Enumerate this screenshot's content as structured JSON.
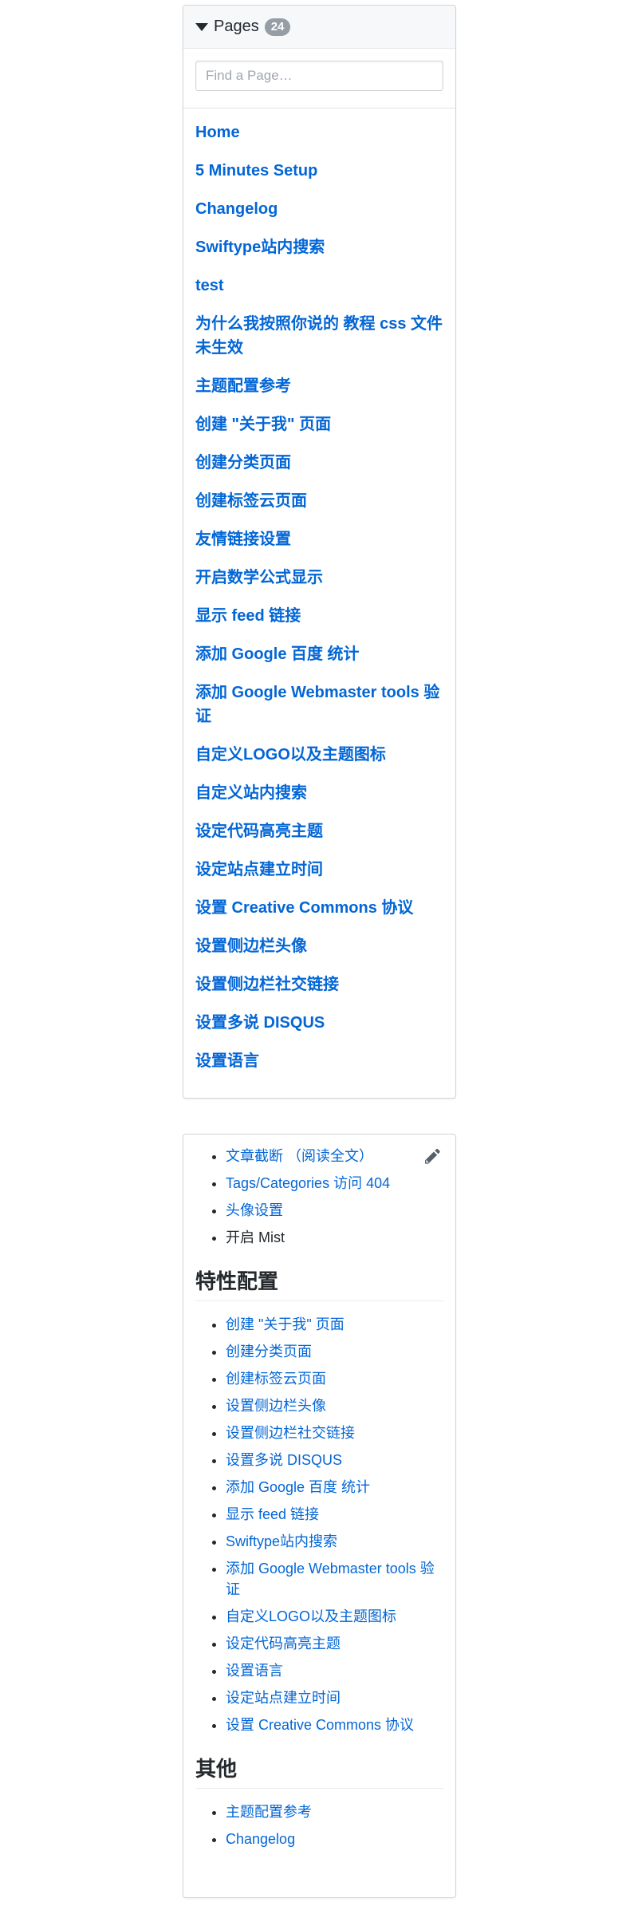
{
  "pages_panel": {
    "title": "Pages",
    "count": "24",
    "search_placeholder": "Find a Page…",
    "pages": [
      "Home",
      "5 Minutes Setup",
      "Changelog",
      "Swiftype站内搜索",
      "test",
      "为什么我按照你说的 教程 css 文件未生效",
      "主题配置参考",
      "创建 \"关于我\" 页面",
      "创建分类页面",
      "创建标签云页面",
      "友情链接设置",
      "开启数学公式显示",
      "显示 feed 链接",
      "添加 Google 百度 统计",
      "添加 Google Webmaster tools 验证",
      "自定义LOGO以及主题图标",
      "自定义站内搜索",
      "设定代码高亮主题",
      "设定站点建立时间",
      "设置 Creative Commons 协议",
      "设置侧边栏头像",
      "设置侧边栏社交链接",
      "设置多说 DISQUS",
      "设置语言"
    ]
  },
  "toc": {
    "top_items": [
      {
        "label": "文章截断 （阅读全文）",
        "link": true
      },
      {
        "label": "Tags/Categories 访问 404",
        "link": true
      },
      {
        "label": "头像设置",
        "link": true
      },
      {
        "label": "开启 Mist",
        "link": false
      }
    ],
    "section_features": {
      "heading": "特性配置",
      "items": [
        "创建 \"关于我\" 页面",
        "创建分类页面",
        "创建标签云页面",
        "设置侧边栏头像",
        "设置侧边栏社交链接",
        "设置多说 DISQUS",
        "添加 Google 百度 统计",
        "显示 feed 链接",
        "Swiftype站内搜索",
        "添加 Google Webmaster tools 验证",
        "自定义LOGO以及主题图标",
        "设定代码高亮主题",
        "设置语言",
        "设定站点建立时间",
        "设置 Creative Commons 协议"
      ]
    },
    "section_other": {
      "heading": "其他",
      "items": [
        "主题配置参考",
        "Changelog"
      ]
    }
  },
  "icons": {
    "caret": "caret-down-icon",
    "edit": "pencil-icon"
  },
  "colors": {
    "link": "#0366d6",
    "badge": "#959da5",
    "text": "#24292e",
    "header_bg": "#f6f8fa",
    "border": "#d1d5da"
  }
}
